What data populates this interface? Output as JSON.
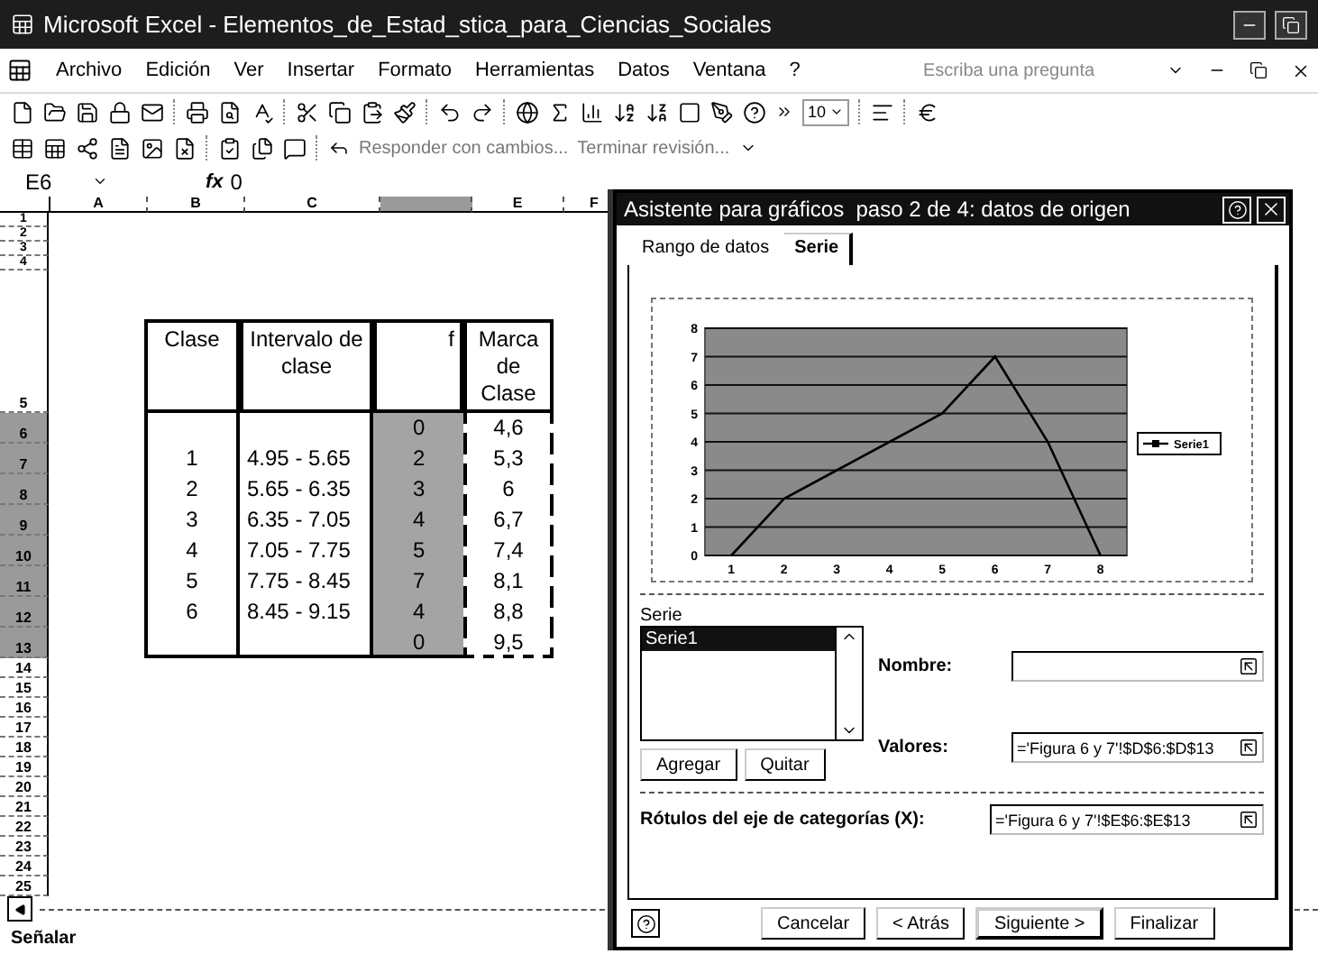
{
  "window": {
    "title": "Microsoft Excel - Elementos_de_Estad_stica_para_Ciencias_Sociales"
  },
  "menu": [
    "Archivo",
    "Edición",
    "Ver",
    "Insertar",
    "Formato",
    "Herramientas",
    "Datos",
    "Ventana",
    "?"
  ],
  "help_box": {
    "placeholder": "Escriba una pregunta"
  },
  "toolbar": {
    "font_size": "10"
  },
  "review_toolbar": {
    "reply": "Responder con cambios...",
    "end": "Terminar revisión..."
  },
  "formula_bar": {
    "cell": "E6",
    "fx": "fx",
    "value": "0"
  },
  "sheet": {
    "columns": [
      {
        "label": "A",
        "selected": false
      },
      {
        "label": "B",
        "selected": false
      },
      {
        "label": "C",
        "selected": false
      },
      {
        "selected": true
      },
      {
        "label": "E",
        "selected": false
      },
      {
        "label": "F",
        "selected": false
      }
    ],
    "rows": [
      {
        "label": "1",
        "selected": false
      },
      {
        "label": "2",
        "selected": false
      },
      {
        "label": "3",
        "selected": false
      },
      {
        "label": "4",
        "selected": false
      },
      {
        "label": "5",
        "selected": false
      },
      {
        "label": "6",
        "selected": true
      },
      {
        "label": "7",
        "selected": true
      },
      {
        "label": "8",
        "selected": true
      },
      {
        "label": "9",
        "selected": true
      },
      {
        "label": "10",
        "selected": true
      },
      {
        "label": "11",
        "selected": true
      },
      {
        "label": "12",
        "selected": true
      },
      {
        "label": "13",
        "selected": true
      },
      {
        "label": "14",
        "selected": false
      },
      {
        "label": "15",
        "selected": false
      },
      {
        "label": "16",
        "selected": false
      },
      {
        "label": "17",
        "selected": false
      },
      {
        "label": "18",
        "selected": false
      },
      {
        "label": "19",
        "selected": false
      },
      {
        "label": "20",
        "selected": false
      },
      {
        "label": "21",
        "selected": false
      },
      {
        "label": "22",
        "selected": false
      },
      {
        "label": "23",
        "selected": false
      },
      {
        "label": "24",
        "selected": false
      },
      {
        "label": "25",
        "selected": false
      }
    ],
    "table": {
      "headers": [
        "Clase",
        "Intervalo de clase",
        "f",
        "Marca de Clase"
      ],
      "rows": [
        {
          "f": "0",
          "marca": "4,6"
        },
        {
          "clase": "1",
          "intervalo": "4.95 - 5.65",
          "f": "2",
          "marca": "5,3"
        },
        {
          "clase": "2",
          "intervalo": "5.65 - 6.35",
          "f": "3",
          "marca": "6"
        },
        {
          "clase": "3",
          "intervalo": "6.35 - 7.05",
          "f": "4",
          "marca": "6,7"
        },
        {
          "clase": "4",
          "intervalo": "7.05 - 7.75",
          "f": "5",
          "marca": "7,4"
        },
        {
          "clase": "5",
          "intervalo": "7.75 - 8.45",
          "f": "7",
          "marca": "8,1"
        },
        {
          "clase": "6",
          "intervalo": "8.45 - 9.15",
          "f": "4",
          "marca": "8,8"
        },
        {
          "f": "0",
          "marca": "9,5"
        }
      ]
    }
  },
  "status_bar": "Señalar",
  "dialog": {
    "title": "Asistente para gráficos  paso 2 de 4: datos de origen",
    "tabs": [
      {
        "label": "Rango de datos",
        "selected": false
      },
      {
        "label": "Serie",
        "selected": true
      }
    ],
    "chart_data": {
      "type": "line",
      "grid": true,
      "categories": [
        "1",
        "2",
        "3",
        "4",
        "5",
        "6",
        "7",
        "8"
      ],
      "ylim": [
        0,
        8
      ],
      "yticks": [
        0,
        1,
        2,
        3,
        4,
        5,
        6,
        7,
        8
      ],
      "series": [
        {
          "name": "Serie1",
          "color": "#000000",
          "values": [
            0,
            2,
            3,
            4,
            5,
            7,
            4,
            0
          ]
        }
      ]
    },
    "series_label": "Serie",
    "series_list": [
      {
        "label": "Serie1",
        "selected": true
      }
    ],
    "list_buttons": [
      "Agregar",
      "Quitar"
    ],
    "fields": [
      {
        "label": "Nombre:"
      },
      {
        "label": "Valores:",
        "value": "='Figura 6 y 7'!$D$6:$D$13"
      }
    ],
    "category_field": {
      "label": "Rótulos del eje de categorías (X):",
      "value": "='Figura 6 y 7'!$E$6:$E$13"
    },
    "buttons": [
      {
        "label": "Cancelar",
        "default": false
      },
      {
        "label": "< Atrás",
        "default": false
      },
      {
        "label": "Siguiente >",
        "default": true
      },
      {
        "label": "Finalizar",
        "default": false
      }
    ]
  }
}
